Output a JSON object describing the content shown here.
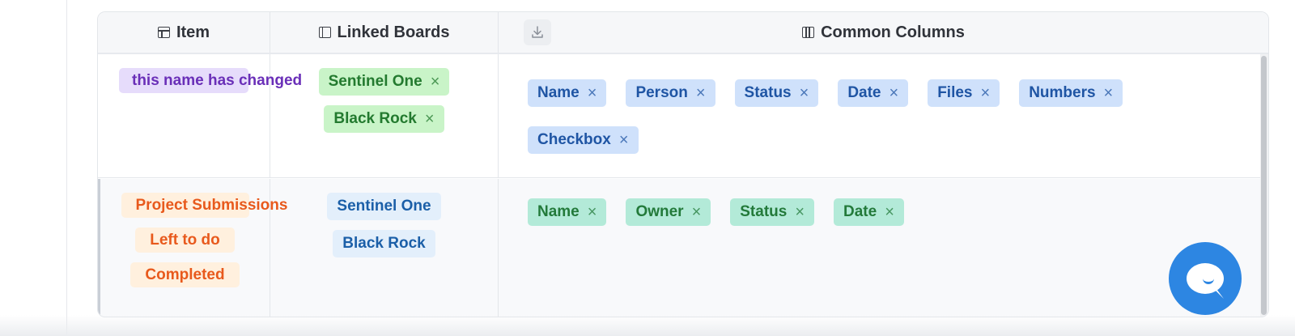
{
  "table": {
    "headers": {
      "item": "Item",
      "linked_boards": "Linked Boards",
      "common_columns": "Common Columns"
    },
    "rows": [
      {
        "item_chips": [
          "this name has changed"
        ],
        "linked_boards": [
          "Sentinel One",
          "Black Rock"
        ],
        "linked_boards_removable": true,
        "common_columns": [
          "Name",
          "Person",
          "Status",
          "Date",
          "Files",
          "Numbers",
          "Checkbox"
        ]
      },
      {
        "item_chips": [
          "Project Submissions",
          "Left to do",
          "Completed"
        ],
        "linked_boards": [
          "Sentinel One",
          "Black Rock"
        ],
        "linked_boards_removable": false,
        "common_columns": [
          "Name",
          "Owner",
          "Status",
          "Date"
        ]
      }
    ]
  },
  "icons": {
    "item_header": "item-column-icon",
    "linked_boards_header": "board-icon",
    "common_columns_header": "columns-icon",
    "download": "download-icon",
    "remove": "close-icon",
    "chat": "chat-icon"
  },
  "remove_glyph": "×",
  "colors": {
    "purple_chip_bg": "#e6dcfb",
    "green_chip_bg": "#c9f4c8",
    "blue_chip_bg": "#cfe1fb",
    "teal_chip_bg": "#b3ead8",
    "orange_chip_bg": "#fff0de",
    "chat_button": "#2d86e2"
  }
}
